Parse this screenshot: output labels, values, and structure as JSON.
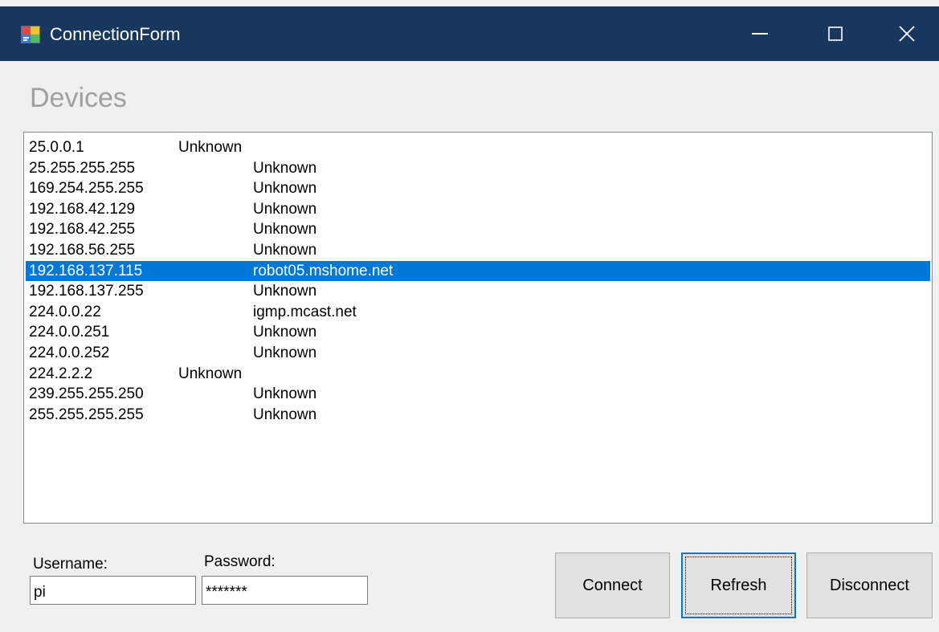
{
  "window": {
    "title": "ConnectionForm"
  },
  "heading": "Devices",
  "devices": [
    {
      "ip": "25.0.0.1",
      "host": "Unknown",
      "host_offset": "short"
    },
    {
      "ip": "25.255.255.255",
      "host": "Unknown"
    },
    {
      "ip": "169.254.255.255",
      "host": "Unknown"
    },
    {
      "ip": "192.168.42.129",
      "host": "Unknown"
    },
    {
      "ip": "192.168.42.255",
      "host": "Unknown"
    },
    {
      "ip": "192.168.56.255",
      "host": "Unknown"
    },
    {
      "ip": "192.168.137.115",
      "host": "robot05.mshome.net",
      "selected": true
    },
    {
      "ip": "192.168.137.255",
      "host": "Unknown"
    },
    {
      "ip": "224.0.0.22",
      "host": "igmp.mcast.net"
    },
    {
      "ip": "224.0.0.251",
      "host": "Unknown"
    },
    {
      "ip": "224.0.0.252",
      "host": "Unknown"
    },
    {
      "ip": "224.2.2.2",
      "host": "Unknown",
      "host_offset": "short"
    },
    {
      "ip": "239.255.255.250",
      "host": "Unknown"
    },
    {
      "ip": "255.255.255.255",
      "host": "Unknown"
    }
  ],
  "login": {
    "username_label": "Username:",
    "username_value": "pi",
    "password_label": "Password:",
    "password_value": "*******"
  },
  "buttons": {
    "connect": "Connect",
    "refresh": "Refresh",
    "disconnect": "Disconnect"
  },
  "colors": {
    "titlebar": "#17375e",
    "selection": "#0078d7"
  },
  "icons": {
    "app": "app-window-icon",
    "minimize": "minimize-icon",
    "maximize": "maximize-icon",
    "close": "close-icon"
  }
}
